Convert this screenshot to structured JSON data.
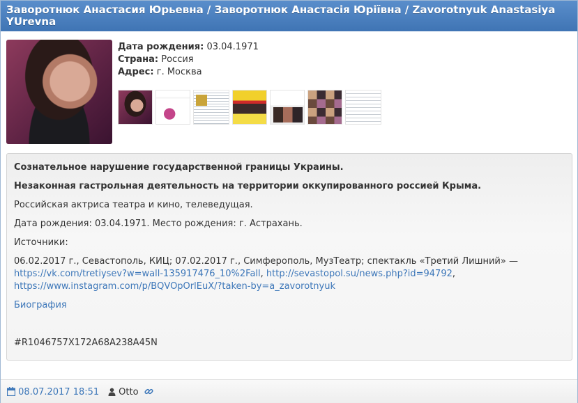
{
  "header": {
    "title": "Заворотнюк Анастасия Юрьевна / Заворотнюк Анастасія Юріївна / Zavorotnyuk Anastasiya YUrevna"
  },
  "profile": {
    "birth_label": "Дата рождения:",
    "birth_value": "03.04.1971",
    "country_label": "Страна:",
    "country_value": "Россия",
    "address_label": "Адрес:",
    "address_value": "г. Москва"
  },
  "thumbnails_count": 7,
  "content": {
    "bold1": "Сознательное нарушение государственной границы Украины.",
    "bold2": "Незаконная гастрольная деятельность на территории оккупированного россией Крыма.",
    "line1": "Российская актриса театра и кино, телеведущая.",
    "line2": "Дата рождения: 03.04.1971. Место рождения: г. Астрахань.",
    "sources_label": "Источники:",
    "sources_text": "06.02.2017 г., Севастополь, КИЦ; 07.02.2017 г., Симферополь, МузТеатр; спектакль «Третий Лишний» —",
    "link1": "https://vk.com/tretiysev?w=wall-135917476_10%2Fall",
    "sep1": ", ",
    "link2": "http://sevastopol.su/news.php?id=94792",
    "sep2": ",",
    "link3": "https://www.instagram.com/p/BQVOpOrlEuX/?taken-by=a_zavorotnyuk",
    "biography_link": "Биография",
    "hash": "#R1046757X172A68A238A45N"
  },
  "footer": {
    "datetime": "08.07.2017 18:51",
    "author": "Otto"
  },
  "colors": {
    "header_bg": "#4a80c0",
    "link": "#3d77b9"
  },
  "icons": {
    "calendar": "calendar-icon",
    "user": "user-icon",
    "link": "link-icon"
  }
}
